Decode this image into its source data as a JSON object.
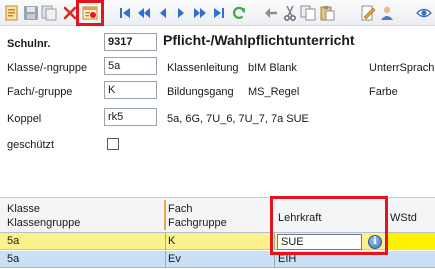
{
  "toolbar": {
    "buttons": [
      {
        "name": "new-record-icon",
        "color": "#e2a33a"
      },
      {
        "name": "save-icon",
        "color": "#8a8f99"
      },
      {
        "name": "copy-record-icon",
        "color": "#9aa0a8"
      },
      {
        "name": "delete-icon",
        "color": "#d42b2b"
      },
      {
        "name": "record-details-icon",
        "color": "#e2a33a"
      },
      {
        "name": "first-record-icon",
        "color": "#2f6fd1"
      },
      {
        "name": "previous-page-icon",
        "color": "#2f6fd1"
      },
      {
        "name": "previous-record-icon",
        "color": "#2f6fd1"
      },
      {
        "name": "next-record-icon",
        "color": "#2f6fd1"
      },
      {
        "name": "next-page-icon",
        "color": "#2f6fd1"
      },
      {
        "name": "last-record-icon",
        "color": "#2f6fd1"
      },
      {
        "name": "refresh-icon",
        "color": "#39a845"
      },
      {
        "name": "back-arrow-icon",
        "color": "#8a8f99"
      },
      {
        "name": "cut-icon",
        "color": "#7a7f88"
      },
      {
        "name": "copy-icon",
        "color": "#8a8f99"
      },
      {
        "name": "paste-icon",
        "color": "#c9a24a"
      },
      {
        "name": "edit-document-icon",
        "color": "#d9a43c"
      },
      {
        "name": "user-icon",
        "color": "#4a7bc4"
      },
      {
        "name": "view-icon",
        "color": "#3a6fc2"
      }
    ]
  },
  "form": {
    "title": "Pflicht-/Wahlpflichtunterricht",
    "schulnr_label": "Schulnr.",
    "schulnr_value": "9317",
    "klasse_label": "Klasse/-ngruppe",
    "klasse_value": "5a",
    "klassenleitung_label": "Klassenleitung",
    "klassenleitung_value": "bIM Blank",
    "unterrsprach_label": "UnterrSprach",
    "fach_label": "Fach/-gruppe",
    "fach_value": "K",
    "bildungsgang_label": "Bildungsgang",
    "bildungsgang_value": "MS_Regel",
    "farbe_label": "Farbe",
    "koppel_label": "Koppel",
    "koppel_value": "rk5",
    "koppel_classes": "5a, 6G, 7U_6, 7U_7, 7a SUE",
    "geschuetzt_label": "geschützt"
  },
  "grid": {
    "headers": {
      "klasse_line1": "Klasse",
      "klasse_line2": "Klassengruppe",
      "fach_line1": "Fach",
      "fach_line2": "Fachgruppe",
      "lehrkraft": "Lehrkraft",
      "wstd": "WStd"
    },
    "rows": [
      {
        "klasse": "5a",
        "fach": "K",
        "lehrkraft": "SUE"
      },
      {
        "klasse": "5a",
        "fach": "Ev",
        "lehrkraft": "EIH"
      }
    ],
    "info_glyph": "i"
  },
  "colors": {
    "highlight": "#e3141b",
    "row_selected": "#fbf28c",
    "row_alt": "#c9e0f5"
  }
}
